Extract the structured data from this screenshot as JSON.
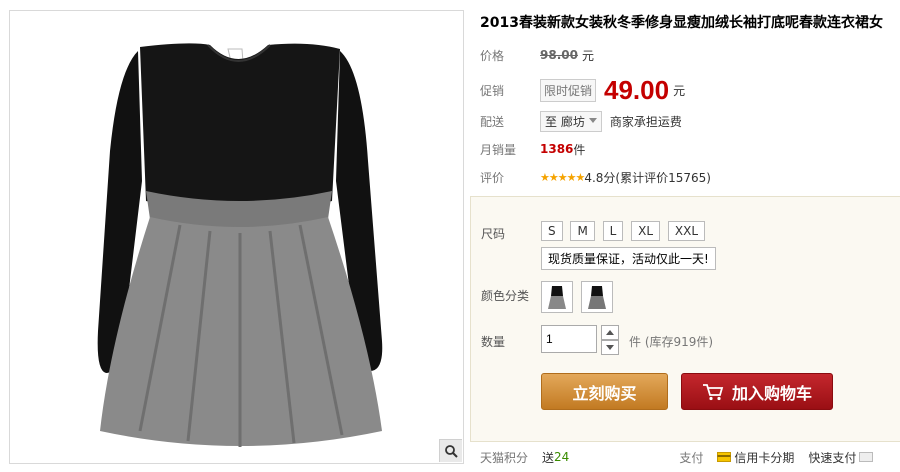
{
  "product": {
    "title": "2013春装新款女装秋冬季修身显瘦加绒长袖打底呢春款连衣裙女"
  },
  "price": {
    "label": "价格",
    "original": "98.00",
    "unit": "元"
  },
  "promo": {
    "label": "促销",
    "tag": "限时促销",
    "price": "49.00",
    "unit": "元"
  },
  "shipping": {
    "label": "配送",
    "destination": "至 廊坊",
    "note": "商家承担运费"
  },
  "monthly_sales": {
    "label": "月销量",
    "count": "1386",
    "unit": "件"
  },
  "rating": {
    "label": "评价",
    "stars": "★★★★★",
    "text": "4.8分(累计评价15765)"
  },
  "options": {
    "size_label": "尺码",
    "sizes": [
      "S",
      "M",
      "L",
      "XL",
      "XXL"
    ],
    "notice": "现货质量保证，活动仅此一天!",
    "color_label": "颜色分类",
    "qty_label": "数量",
    "qty_value": "1",
    "stock_text": "件 (库存919件)"
  },
  "actions": {
    "buy": "立刻购买",
    "cart": "加入购物车"
  },
  "bottom": {
    "points_label": "天猫积分",
    "points_value_prefix": "送",
    "points_value": "24",
    "pay_label": "支付",
    "pay_credit": "信用卡分期",
    "pay_fast": "快速支付"
  },
  "colors": {
    "price_red": "#c40000",
    "buy_orange": "#d38c36",
    "cart_red": "#b01a1f"
  }
}
